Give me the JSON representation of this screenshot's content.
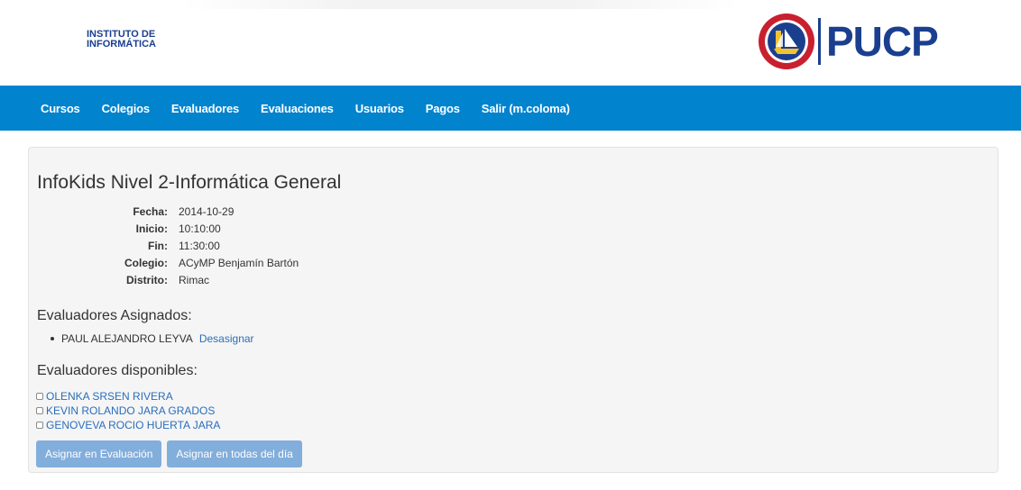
{
  "header": {
    "institute_line1": "INSTITUTO DE",
    "institute_line2": "INFORMÁTICA",
    "brand_text": "PUCP",
    "seal_text": "ET LUX IN TENEBRIS LUCET",
    "seal_bottom_text": "PUCP"
  },
  "nav": {
    "items": [
      {
        "label": "Cursos"
      },
      {
        "label": "Colegios"
      },
      {
        "label": "Evaluadores"
      },
      {
        "label": "Evaluaciones"
      },
      {
        "label": "Usuarios"
      },
      {
        "label": "Pagos"
      },
      {
        "label": "Salir (m.coloma)"
      }
    ]
  },
  "evaluation": {
    "title": "InfoKids Nivel 2-Informática General",
    "details": [
      {
        "label": "Fecha:",
        "value": "2014-10-29"
      },
      {
        "label": "Inicio:",
        "value": "10:10:00"
      },
      {
        "label": "Fin:",
        "value": "11:30:00"
      },
      {
        "label": "Colegio:",
        "value": "ACyMP Benjamín Bartón"
      },
      {
        "label": "Distrito:",
        "value": "Rimac"
      }
    ]
  },
  "assigned": {
    "heading": "Evaluadores Asignados:",
    "items": [
      {
        "name": "PAUL ALEJANDRO LEYVA",
        "action": "Desasignar"
      }
    ]
  },
  "available": {
    "heading": "Evaluadores disponibles:",
    "items": [
      {
        "name": "OLENKA SRSEN RIVERA",
        "checked": false
      },
      {
        "name": "KEVIN ROLANDO JARA GRADOS",
        "checked": false
      },
      {
        "name": "GENOVEVA ROCIO HUERTA JARA",
        "checked": false
      }
    ]
  },
  "buttons": {
    "assign_one": "Asignar en Evaluación",
    "assign_all": "Asignar en todas del día"
  },
  "colors": {
    "navbar": "#0283ce",
    "brand": "#1b3f8f",
    "link": "#2a6ebb",
    "button": "#82aedc",
    "panel": "#f5f5f5"
  }
}
